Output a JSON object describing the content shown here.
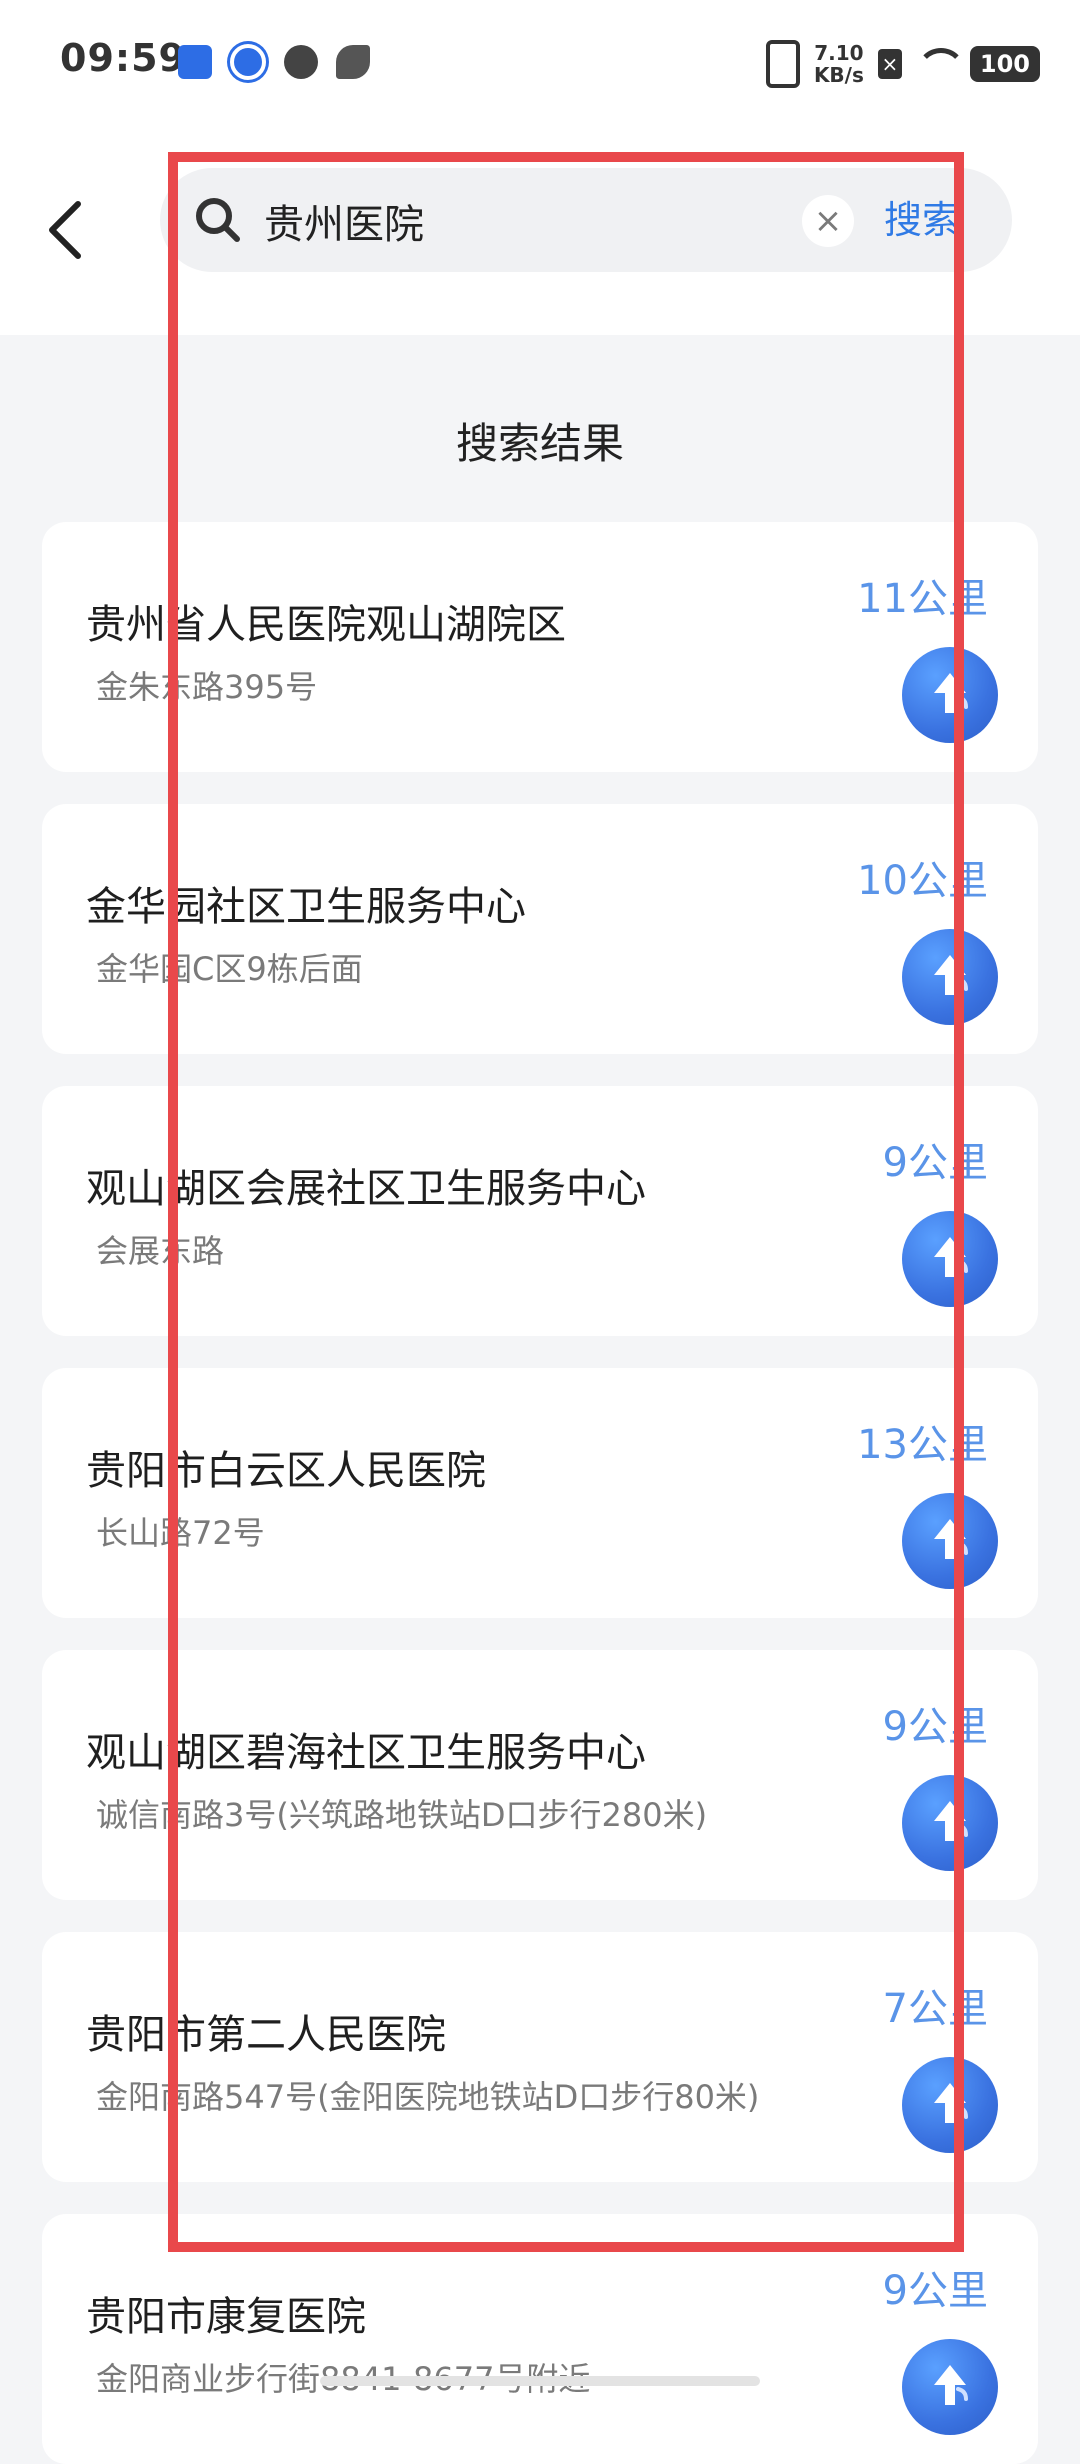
{
  "status": {
    "time": "09:59",
    "net_speed_value": "7.10",
    "net_speed_unit": "KB/s",
    "battery": "100"
  },
  "search": {
    "query": "贵州医院",
    "clear_glyph": "×",
    "button_label": "搜索"
  },
  "results_title": "搜索结果",
  "results": [
    {
      "name": "贵州省人民医院观山湖院区",
      "address": "金朱东路395号",
      "distance": "11公里"
    },
    {
      "name": "金华园社区卫生服务中心",
      "address": "金华园C区9栋后面",
      "distance": "10公里"
    },
    {
      "name": "观山湖区会展社区卫生服务中心",
      "address": "会展东路",
      "distance": "9公里"
    },
    {
      "name": "贵阳市白云区人民医院",
      "address": "长山路72号",
      "distance": "13公里"
    },
    {
      "name": "观山湖区碧海社区卫生服务中心",
      "address": "诚信南路3号(兴筑路地铁站D口步行280米)",
      "distance": "9公里"
    },
    {
      "name": "贵阳市第二人民医院",
      "address": "金阳南路547号(金阳医院地铁站D口步行80米)",
      "distance": "7公里"
    },
    {
      "name": "贵阳市康复医院",
      "address": "金阳商业步行街8841-8677号附近",
      "distance": "9公里"
    }
  ],
  "icons": {
    "back": "chevron-left-icon",
    "search": "search-icon",
    "clear": "close-icon",
    "navigate": "navigate-arrow-icon"
  },
  "colors": {
    "accent": "#2f7ae5",
    "distance": "#5a94e8",
    "annotation": "#e9484b"
  }
}
